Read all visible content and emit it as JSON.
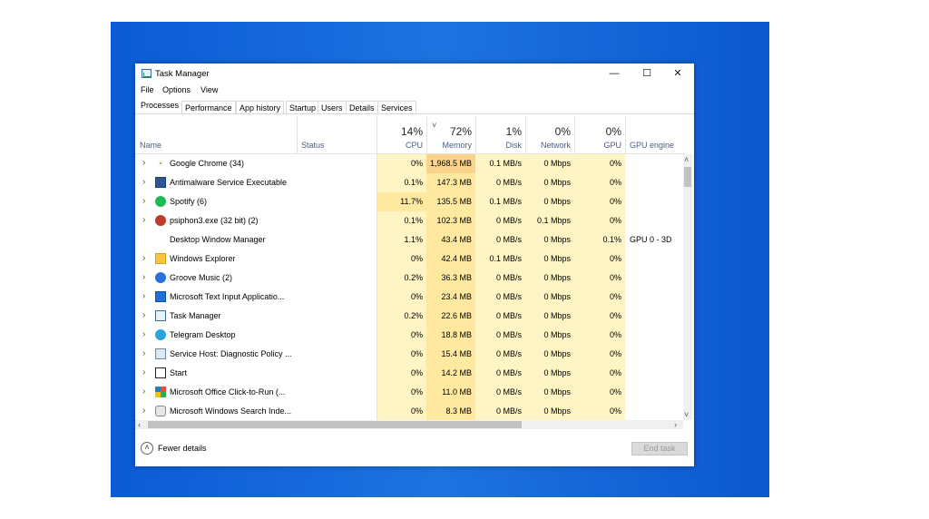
{
  "window": {
    "title": "Task Manager",
    "minimize": "—",
    "maximize": "☐",
    "close": "✕"
  },
  "menu": [
    "File",
    "Options",
    "View"
  ],
  "tabs": [
    "Processes",
    "Performance",
    "App history",
    "Startup",
    "Users",
    "Details",
    "Services"
  ],
  "selected_tab": "Processes",
  "highlighted_tab": "Performance",
  "columns": {
    "name": "Name",
    "status": "Status",
    "cpu": {
      "pct": "14%",
      "label": "CPU"
    },
    "memory": {
      "pct": "72%",
      "label": "Memory",
      "sort": "˅"
    },
    "disk": {
      "pct": "1%",
      "label": "Disk"
    },
    "network": {
      "pct": "0%",
      "label": "Network"
    },
    "gpu": {
      "pct": "0%",
      "label": "GPU"
    },
    "gpu_engine": "GPU engine"
  },
  "processes": [
    {
      "name": "Google Chrome (34)",
      "icon": "chrome-icon",
      "expand": true,
      "cpu": "0%",
      "memory": "1,968.5 MB",
      "disk": "0.1 MB/s",
      "network": "0 Mbps",
      "gpu": "0%",
      "gpu_engine": ""
    },
    {
      "name": "Antimalware Service Executable",
      "icon": "shield-app-icon",
      "expand": true,
      "cpu": "0.1%",
      "memory": "147.3 MB",
      "disk": "0 MB/s",
      "network": "0 Mbps",
      "gpu": "0%",
      "gpu_engine": ""
    },
    {
      "name": "Spotify (6)",
      "icon": "spotify-icon",
      "expand": true,
      "cpu": "11.7%",
      "memory": "135.5 MB",
      "disk": "0.1 MB/s",
      "network": "0 Mbps",
      "gpu": "0%",
      "gpu_engine": ""
    },
    {
      "name": "psiphon3.exe (32 bit) (2)",
      "icon": "psiphon-icon",
      "expand": true,
      "cpu": "0.1%",
      "memory": "102.3 MB",
      "disk": "0 MB/s",
      "network": "0.1 Mbps",
      "gpu": "0%",
      "gpu_engine": ""
    },
    {
      "name": "Desktop Window Manager",
      "icon": "window-manager-icon",
      "expand": false,
      "cpu": "1.1%",
      "memory": "43.4 MB",
      "disk": "0 MB/s",
      "network": "0 Mbps",
      "gpu": "0.1%",
      "gpu_engine": "GPU 0 - 3D"
    },
    {
      "name": "Windows Explorer",
      "icon": "folder-icon",
      "expand": true,
      "cpu": "0%",
      "memory": "42.4 MB",
      "disk": "0.1 MB/s",
      "network": "0 Mbps",
      "gpu": "0%",
      "gpu_engine": ""
    },
    {
      "name": "Groove Music (2)",
      "icon": "groove-icon",
      "expand": true,
      "cpu": "0.2%",
      "memory": "36.3 MB",
      "disk": "0 MB/s",
      "network": "0 Mbps",
      "gpu": "0%",
      "gpu_engine": ""
    },
    {
      "name": "Microsoft Text Input Applicatio...",
      "icon": "app-window-icon",
      "expand": true,
      "cpu": "0%",
      "memory": "23.4 MB",
      "disk": "0 MB/s",
      "network": "0 Mbps",
      "gpu": "0%",
      "gpu_engine": ""
    },
    {
      "name": "Task Manager",
      "icon": "task-manager-icon",
      "expand": true,
      "cpu": "0.2%",
      "memory": "22.6 MB",
      "disk": "0 MB/s",
      "network": "0 Mbps",
      "gpu": "0%",
      "gpu_engine": ""
    },
    {
      "name": "Telegram Desktop",
      "icon": "telegram-icon",
      "expand": true,
      "cpu": "0%",
      "memory": "18.8 MB",
      "disk": "0 MB/s",
      "network": "0 Mbps",
      "gpu": "0%",
      "gpu_engine": ""
    },
    {
      "name": "Service Host: Diagnostic Policy ...",
      "icon": "gear-icon",
      "expand": true,
      "cpu": "0%",
      "memory": "15.4 MB",
      "disk": "0 MB/s",
      "network": "0 Mbps",
      "gpu": "0%",
      "gpu_engine": ""
    },
    {
      "name": "Start",
      "icon": "start-icon",
      "expand": true,
      "cpu": "0%",
      "memory": "14.2 MB",
      "disk": "0 MB/s",
      "network": "0 Mbps",
      "gpu": "0%",
      "gpu_engine": ""
    },
    {
      "name": "Microsoft Office Click-to-Run (...",
      "icon": "office-icon",
      "expand": true,
      "cpu": "0%",
      "memory": "11.0 MB",
      "disk": "0 MB/s",
      "network": "0 Mbps",
      "gpu": "0%",
      "gpu_engine": ""
    },
    {
      "name": "Microsoft Windows Search Inde...",
      "icon": "search-indexer-icon",
      "expand": true,
      "cpu": "0%",
      "memory": "8.3 MB",
      "disk": "0 MB/s",
      "network": "0 Mbps",
      "gpu": "0%",
      "gpu_engine": ""
    }
  ],
  "footer": {
    "fewer_details": "Fewer details",
    "end_task": "End task"
  },
  "colors": {
    "heat_light": "#fff4c4",
    "heat_medium": "#ffe9a0",
    "heat_strong": "#fbd38a",
    "highlight": "#a64ad1",
    "desktop": "#1565dc"
  }
}
